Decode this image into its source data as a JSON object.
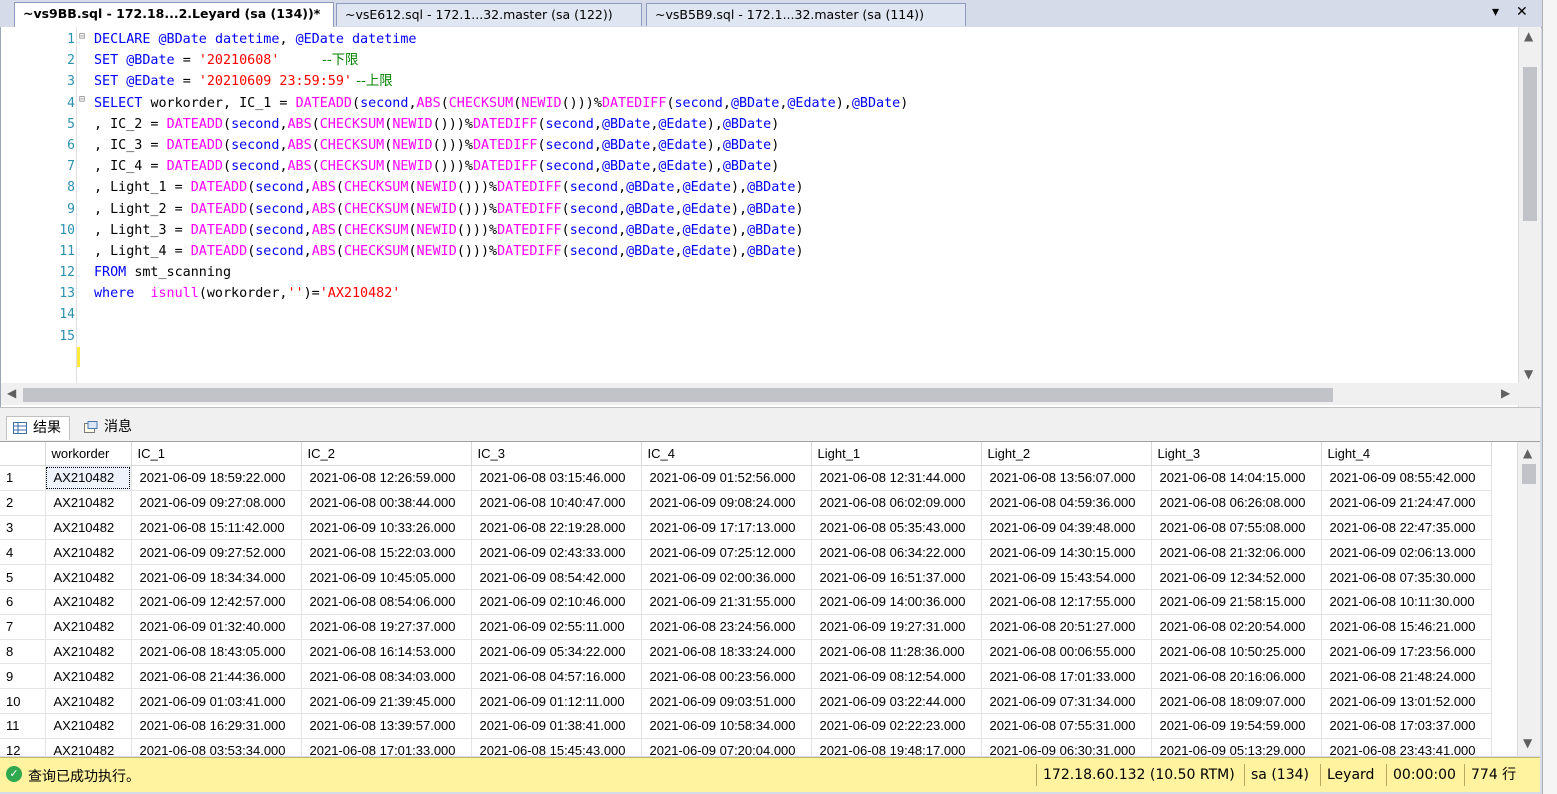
{
  "tabs": [
    {
      "label": "~vs9BB.sql - 172.18...2.Leyard (sa (134))*",
      "active": true
    },
    {
      "label": "~vsE612.sql - 172.1...32.master (sa (122))",
      "active": false
    },
    {
      "label": "~vsB5B9.sql - 172.1...32.master (sa (114))",
      "active": false
    }
  ],
  "tab_controls": {
    "dropdown_icon": "chevron-down-icon",
    "close_icon": "close-icon",
    "dropdown_glyph": "▾",
    "close_glyph": "✕"
  },
  "editor": {
    "line_numbers": [
      "1",
      "2",
      "3",
      "4",
      "5",
      "6",
      "7",
      "8",
      "9",
      "10",
      "11",
      "12",
      "13",
      "14",
      "15"
    ],
    "lines": [
      [
        {
          "t": "DECLARE ",
          "c": "kw"
        },
        {
          "t": "@BDate ",
          "c": "vr"
        },
        {
          "t": "datetime",
          "c": "kw"
        },
        {
          "t": ", ",
          "c": ""
        },
        {
          "t": "@EDate ",
          "c": "vr"
        },
        {
          "t": "datetime",
          "c": "kw"
        }
      ],
      [
        {
          "t": "SET ",
          "c": "kw"
        },
        {
          "t": "@BDate ",
          "c": "vr"
        },
        {
          "t": "= ",
          "c": ""
        },
        {
          "t": "'20210608'",
          "c": "str"
        },
        {
          "t": "          --下限",
          "c": "cm"
        }
      ],
      [
        {
          "t": "SET ",
          "c": "kw"
        },
        {
          "t": "@EDate ",
          "c": "vr"
        },
        {
          "t": "= ",
          "c": ""
        },
        {
          "t": "'20210609 23:59:59'",
          "c": "str"
        },
        {
          "t": " --上限",
          "c": "cm"
        }
      ],
      [
        {
          "t": "SELECT ",
          "c": "kw"
        },
        {
          "t": "workorder, IC_1 = ",
          "c": ""
        },
        {
          "t": "DATEADD",
          "c": "fn"
        },
        {
          "t": "(",
          "c": ""
        },
        {
          "t": "second",
          "c": "kw"
        },
        {
          "t": ",",
          "c": ""
        },
        {
          "t": "ABS",
          "c": "fn"
        },
        {
          "t": "(",
          "c": ""
        },
        {
          "t": "CHECKSUM",
          "c": "fn"
        },
        {
          "t": "(",
          "c": ""
        },
        {
          "t": "NEWID",
          "c": "fn"
        },
        {
          "t": "()))%",
          "c": ""
        },
        {
          "t": "DATEDIFF",
          "c": "fn"
        },
        {
          "t": "(",
          "c": ""
        },
        {
          "t": "second",
          "c": "kw"
        },
        {
          "t": ",",
          "c": ""
        },
        {
          "t": "@BDate",
          "c": "vr"
        },
        {
          "t": ",",
          "c": ""
        },
        {
          "t": "@Edate",
          "c": "vr"
        },
        {
          "t": "),",
          "c": ""
        },
        {
          "t": "@BDate",
          "c": "vr"
        },
        {
          "t": ")",
          "c": ""
        }
      ],
      [
        {
          "t": ", IC_2 = ",
          "c": ""
        },
        {
          "t": "DATEADD",
          "c": "fn"
        },
        {
          "t": "(",
          "c": ""
        },
        {
          "t": "second",
          "c": "kw"
        },
        {
          "t": ",",
          "c": ""
        },
        {
          "t": "ABS",
          "c": "fn"
        },
        {
          "t": "(",
          "c": ""
        },
        {
          "t": "CHECKSUM",
          "c": "fn"
        },
        {
          "t": "(",
          "c": ""
        },
        {
          "t": "NEWID",
          "c": "fn"
        },
        {
          "t": "()))%",
          "c": ""
        },
        {
          "t": "DATEDIFF",
          "c": "fn"
        },
        {
          "t": "(",
          "c": ""
        },
        {
          "t": "second",
          "c": "kw"
        },
        {
          "t": ",",
          "c": ""
        },
        {
          "t": "@BDate",
          "c": "vr"
        },
        {
          "t": ",",
          "c": ""
        },
        {
          "t": "@Edate",
          "c": "vr"
        },
        {
          "t": "),",
          "c": ""
        },
        {
          "t": "@BDate",
          "c": "vr"
        },
        {
          "t": ")",
          "c": ""
        }
      ],
      [
        {
          "t": ", IC_3 = ",
          "c": ""
        },
        {
          "t": "DATEADD",
          "c": "fn"
        },
        {
          "t": "(",
          "c": ""
        },
        {
          "t": "second",
          "c": "kw"
        },
        {
          "t": ",",
          "c": ""
        },
        {
          "t": "ABS",
          "c": "fn"
        },
        {
          "t": "(",
          "c": ""
        },
        {
          "t": "CHECKSUM",
          "c": "fn"
        },
        {
          "t": "(",
          "c": ""
        },
        {
          "t": "NEWID",
          "c": "fn"
        },
        {
          "t": "()))%",
          "c": ""
        },
        {
          "t": "DATEDIFF",
          "c": "fn"
        },
        {
          "t": "(",
          "c": ""
        },
        {
          "t": "second",
          "c": "kw"
        },
        {
          "t": ",",
          "c": ""
        },
        {
          "t": "@BDate",
          "c": "vr"
        },
        {
          "t": ",",
          "c": ""
        },
        {
          "t": "@Edate",
          "c": "vr"
        },
        {
          "t": "),",
          "c": ""
        },
        {
          "t": "@BDate",
          "c": "vr"
        },
        {
          "t": ")",
          "c": ""
        }
      ],
      [
        {
          "t": ", IC_4 = ",
          "c": ""
        },
        {
          "t": "DATEADD",
          "c": "fn"
        },
        {
          "t": "(",
          "c": ""
        },
        {
          "t": "second",
          "c": "kw"
        },
        {
          "t": ",",
          "c": ""
        },
        {
          "t": "ABS",
          "c": "fn"
        },
        {
          "t": "(",
          "c": ""
        },
        {
          "t": "CHECKSUM",
          "c": "fn"
        },
        {
          "t": "(",
          "c": ""
        },
        {
          "t": "NEWID",
          "c": "fn"
        },
        {
          "t": "()))%",
          "c": ""
        },
        {
          "t": "DATEDIFF",
          "c": "fn"
        },
        {
          "t": "(",
          "c": ""
        },
        {
          "t": "second",
          "c": "kw"
        },
        {
          "t": ",",
          "c": ""
        },
        {
          "t": "@BDate",
          "c": "vr"
        },
        {
          "t": ",",
          "c": ""
        },
        {
          "t": "@Edate",
          "c": "vr"
        },
        {
          "t": "),",
          "c": ""
        },
        {
          "t": "@BDate",
          "c": "vr"
        },
        {
          "t": ")",
          "c": ""
        }
      ],
      [
        {
          "t": ", Light_1 = ",
          "c": ""
        },
        {
          "t": "DATEADD",
          "c": "fn"
        },
        {
          "t": "(",
          "c": ""
        },
        {
          "t": "second",
          "c": "kw"
        },
        {
          "t": ",",
          "c": ""
        },
        {
          "t": "ABS",
          "c": "fn"
        },
        {
          "t": "(",
          "c": ""
        },
        {
          "t": "CHECKSUM",
          "c": "fn"
        },
        {
          "t": "(",
          "c": ""
        },
        {
          "t": "NEWID",
          "c": "fn"
        },
        {
          "t": "()))%",
          "c": ""
        },
        {
          "t": "DATEDIFF",
          "c": "fn"
        },
        {
          "t": "(",
          "c": ""
        },
        {
          "t": "second",
          "c": "kw"
        },
        {
          "t": ",",
          "c": ""
        },
        {
          "t": "@BDate",
          "c": "vr"
        },
        {
          "t": ",",
          "c": ""
        },
        {
          "t": "@Edate",
          "c": "vr"
        },
        {
          "t": "),",
          "c": ""
        },
        {
          "t": "@BDate",
          "c": "vr"
        },
        {
          "t": ")",
          "c": ""
        }
      ],
      [
        {
          "t": ", Light_2 = ",
          "c": ""
        },
        {
          "t": "DATEADD",
          "c": "fn"
        },
        {
          "t": "(",
          "c": ""
        },
        {
          "t": "second",
          "c": "kw"
        },
        {
          "t": ",",
          "c": ""
        },
        {
          "t": "ABS",
          "c": "fn"
        },
        {
          "t": "(",
          "c": ""
        },
        {
          "t": "CHECKSUM",
          "c": "fn"
        },
        {
          "t": "(",
          "c": ""
        },
        {
          "t": "NEWID",
          "c": "fn"
        },
        {
          "t": "()))%",
          "c": ""
        },
        {
          "t": "DATEDIFF",
          "c": "fn"
        },
        {
          "t": "(",
          "c": ""
        },
        {
          "t": "second",
          "c": "kw"
        },
        {
          "t": ",",
          "c": ""
        },
        {
          "t": "@BDate",
          "c": "vr"
        },
        {
          "t": ",",
          "c": ""
        },
        {
          "t": "@Edate",
          "c": "vr"
        },
        {
          "t": "),",
          "c": ""
        },
        {
          "t": "@BDate",
          "c": "vr"
        },
        {
          "t": ")",
          "c": ""
        }
      ],
      [
        {
          "t": ", Light_3 = ",
          "c": ""
        },
        {
          "t": "DATEADD",
          "c": "fn"
        },
        {
          "t": "(",
          "c": ""
        },
        {
          "t": "second",
          "c": "kw"
        },
        {
          "t": ",",
          "c": ""
        },
        {
          "t": "ABS",
          "c": "fn"
        },
        {
          "t": "(",
          "c": ""
        },
        {
          "t": "CHECKSUM",
          "c": "fn"
        },
        {
          "t": "(",
          "c": ""
        },
        {
          "t": "NEWID",
          "c": "fn"
        },
        {
          "t": "()))%",
          "c": ""
        },
        {
          "t": "DATEDIFF",
          "c": "fn"
        },
        {
          "t": "(",
          "c": ""
        },
        {
          "t": "second",
          "c": "kw"
        },
        {
          "t": ",",
          "c": ""
        },
        {
          "t": "@BDate",
          "c": "vr"
        },
        {
          "t": ",",
          "c": ""
        },
        {
          "t": "@Edate",
          "c": "vr"
        },
        {
          "t": "),",
          "c": ""
        },
        {
          "t": "@BDate",
          "c": "vr"
        },
        {
          "t": ")",
          "c": ""
        }
      ],
      [
        {
          "t": ", Light_4 = ",
          "c": ""
        },
        {
          "t": "DATEADD",
          "c": "fn"
        },
        {
          "t": "(",
          "c": ""
        },
        {
          "t": "second",
          "c": "kw"
        },
        {
          "t": ",",
          "c": ""
        },
        {
          "t": "ABS",
          "c": "fn"
        },
        {
          "t": "(",
          "c": ""
        },
        {
          "t": "CHECKSUM",
          "c": "fn"
        },
        {
          "t": "(",
          "c": ""
        },
        {
          "t": "NEWID",
          "c": "fn"
        },
        {
          "t": "()))%",
          "c": ""
        },
        {
          "t": "DATEDIFF",
          "c": "fn"
        },
        {
          "t": "(",
          "c": ""
        },
        {
          "t": "second",
          "c": "kw"
        },
        {
          "t": ",",
          "c": ""
        },
        {
          "t": "@BDate",
          "c": "vr"
        },
        {
          "t": ",",
          "c": ""
        },
        {
          "t": "@Edate",
          "c": "vr"
        },
        {
          "t": "),",
          "c": ""
        },
        {
          "t": "@BDate",
          "c": "vr"
        },
        {
          "t": ")",
          "c": ""
        }
      ],
      [
        {
          "t": "FROM ",
          "c": "kw"
        },
        {
          "t": "smt_scanning",
          "c": ""
        }
      ],
      [
        {
          "t": "where  ",
          "c": "kw"
        },
        {
          "t": "isnull",
          "c": "fn"
        },
        {
          "t": "(workorder,",
          "c": ""
        },
        {
          "t": "''",
          "c": "str"
        },
        {
          "t": ")=",
          "c": ""
        },
        {
          "t": "'AX210482'",
          "c": "str"
        }
      ],
      [],
      []
    ]
  },
  "result_tabs": [
    {
      "label": "结果",
      "icon": "grid-icon",
      "active": true
    },
    {
      "label": "消息",
      "icon": "message-icon",
      "active": false
    }
  ],
  "grid": {
    "columns": [
      "",
      "workorder",
      "IC_1",
      "IC_2",
      "IC_3",
      "IC_4",
      "Light_1",
      "Light_2",
      "Light_3",
      "Light_4"
    ],
    "rows": [
      [
        "1",
        "AX210482",
        "2021-06-09 18:59:22.000",
        "2021-06-08 12:26:59.000",
        "2021-06-08 03:15:46.000",
        "2021-06-09 01:52:56.000",
        "2021-06-08 12:31:44.000",
        "2021-06-08 13:56:07.000",
        "2021-06-08 14:04:15.000",
        "2021-06-09 08:55:42.000"
      ],
      [
        "2",
        "AX210482",
        "2021-06-09 09:27:08.000",
        "2021-06-08 00:38:44.000",
        "2021-06-08 10:40:47.000",
        "2021-06-09 09:08:24.000",
        "2021-06-08 06:02:09.000",
        "2021-06-08 04:59:36.000",
        "2021-06-08 06:26:08.000",
        "2021-06-09 21:24:47.000"
      ],
      [
        "3",
        "AX210482",
        "2021-06-08 15:11:42.000",
        "2021-06-09 10:33:26.000",
        "2021-06-08 22:19:28.000",
        "2021-06-09 17:17:13.000",
        "2021-06-08 05:35:43.000",
        "2021-06-09 04:39:48.000",
        "2021-06-08 07:55:08.000",
        "2021-06-08 22:47:35.000"
      ],
      [
        "4",
        "AX210482",
        "2021-06-09 09:27:52.000",
        "2021-06-08 15:22:03.000",
        "2021-06-09 02:43:33.000",
        "2021-06-09 07:25:12.000",
        "2021-06-08 06:34:22.000",
        "2021-06-09 14:30:15.000",
        "2021-06-08 21:32:06.000",
        "2021-06-09 02:06:13.000"
      ],
      [
        "5",
        "AX210482",
        "2021-06-09 18:34:34.000",
        "2021-06-09 10:45:05.000",
        "2021-06-09 08:54:42.000",
        "2021-06-09 02:00:36.000",
        "2021-06-09 16:51:37.000",
        "2021-06-09 15:43:54.000",
        "2021-06-09 12:34:52.000",
        "2021-06-08 07:35:30.000"
      ],
      [
        "6",
        "AX210482",
        "2021-06-09 12:42:57.000",
        "2021-06-08 08:54:06.000",
        "2021-06-09 02:10:46.000",
        "2021-06-09 21:31:55.000",
        "2021-06-09 14:00:36.000",
        "2021-06-08 12:17:55.000",
        "2021-06-09 21:58:15.000",
        "2021-06-08 10:11:30.000"
      ],
      [
        "7",
        "AX210482",
        "2021-06-09 01:32:40.000",
        "2021-06-08 19:27:37.000",
        "2021-06-09 02:55:11.000",
        "2021-06-08 23:24:56.000",
        "2021-06-09 19:27:31.000",
        "2021-06-08 20:51:27.000",
        "2021-06-08 02:20:54.000",
        "2021-06-08 15:46:21.000"
      ],
      [
        "8",
        "AX210482",
        "2021-06-08 18:43:05.000",
        "2021-06-08 16:14:53.000",
        "2021-06-09 05:34:22.000",
        "2021-06-08 18:33:24.000",
        "2021-06-08 11:28:36.000",
        "2021-06-08 00:06:55.000",
        "2021-06-08 10:50:25.000",
        "2021-06-09 17:23:56.000"
      ],
      [
        "9",
        "AX210482",
        "2021-06-08 21:44:36.000",
        "2021-06-08 08:34:03.000",
        "2021-06-08 04:57:16.000",
        "2021-06-08 00:23:56.000",
        "2021-06-09 08:12:54.000",
        "2021-06-08 17:01:33.000",
        "2021-06-08 20:16:06.000",
        "2021-06-08 21:48:24.000"
      ],
      [
        "10",
        "AX210482",
        "2021-06-09 01:03:41.000",
        "2021-06-09 21:39:45.000",
        "2021-06-09 01:12:11.000",
        "2021-06-09 09:03:51.000",
        "2021-06-09 03:22:44.000",
        "2021-06-09 07:31:34.000",
        "2021-06-08 18:09:07.000",
        "2021-06-09 13:01:52.000"
      ],
      [
        "11",
        "AX210482",
        "2021-06-08 16:29:31.000",
        "2021-06-08 13:39:57.000",
        "2021-06-09 01:38:41.000",
        "2021-06-09 10:58:34.000",
        "2021-06-09 02:22:23.000",
        "2021-06-08 07:55:31.000",
        "2021-06-09 19:54:59.000",
        "2021-06-08 17:03:37.000"
      ],
      [
        "12",
        "AX210482",
        "2021-06-08 03:53:34.000",
        "2021-06-08 17:01:33.000",
        "2021-06-08 15:45:43.000",
        "2021-06-09 07:20:04.000",
        "2021-06-08 19:48:17.000",
        "2021-06-09 06:30:31.000",
        "2021-06-09 05:13:29.000",
        "2021-06-08 23:43:41.000"
      ]
    ]
  },
  "status": {
    "message": "查询已成功执行。",
    "server": "172.18.60.132 (10.50 RTM)",
    "user": "sa (134)",
    "database": "Leyard",
    "elapsed": "00:00:00",
    "rows": "774 行",
    "background_color": "#fff3a0"
  }
}
